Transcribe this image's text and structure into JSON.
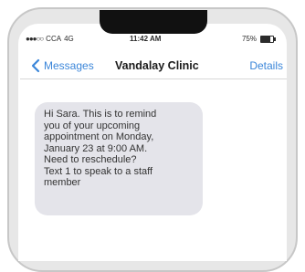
{
  "status_bar": {
    "carrier": "CCA",
    "network": "4G",
    "time": "11:42 AM",
    "battery": "75%",
    "battery_level": 0.75,
    "signal_icon": "signal-dots-icon",
    "battery_icon": "battery-icon"
  },
  "nav": {
    "back_label": "Messages",
    "back_icon": "chevron-left-icon",
    "title": "Vandalay Clinic",
    "details_label": "Details"
  },
  "message": {
    "text": "Hi Sara. This is to remind\nyou of your upcoming\nappointment on Monday,\nJanuary 23 at 9:00 AM.\nNeed to reschedule?\nText 1 to speak to a staff\nmember"
  },
  "colors": {
    "accent": "#3b86d9",
    "bubble": "#e4e4ea"
  }
}
